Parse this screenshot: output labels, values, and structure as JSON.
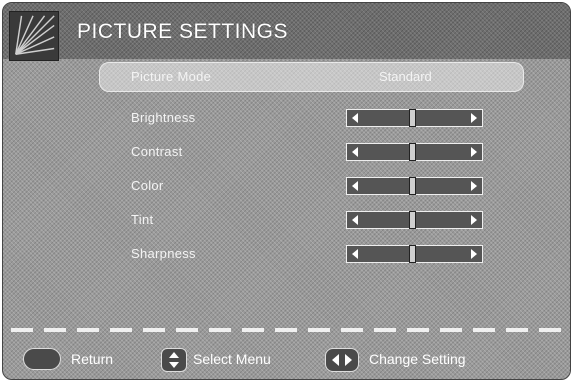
{
  "header": {
    "title": "PICTURE SETTINGS",
    "icon": "picture-settings-icon"
  },
  "settings": [
    {
      "label": "Picture Mode",
      "value": "Standard",
      "type": "value"
    },
    {
      "label": "Brightness",
      "type": "slider",
      "level": 0.48
    },
    {
      "label": "Contrast",
      "type": "slider",
      "level": 0.48
    },
    {
      "label": "Color",
      "type": "slider",
      "level": 0.48
    },
    {
      "label": "Tint",
      "type": "slider",
      "level": 0.48
    },
    {
      "label": "Sharpness",
      "type": "slider",
      "level": 0.48
    }
  ],
  "footer": {
    "return_label": "Return",
    "select_label": "Select Menu",
    "change_label": "Change Setting"
  },
  "colors": {
    "background": "#9a9a9a",
    "header": "#6e6e6e",
    "text": "#ffffff"
  }
}
